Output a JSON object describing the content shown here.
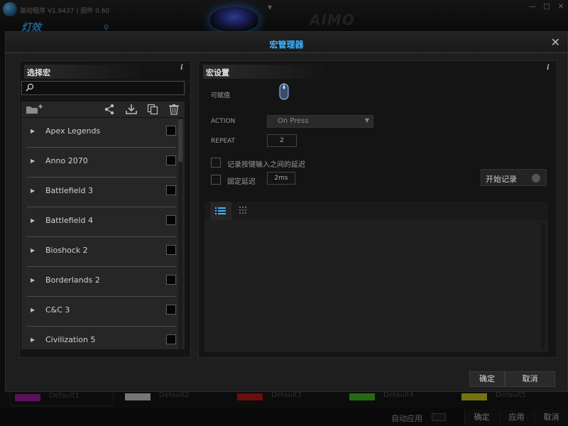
{
  "app": {
    "version_text": "驱动程序 V1.9437 | 固件 0.60",
    "nav_left_label": "灯效",
    "banner_text": "AIMO",
    "window_controls": {
      "minimize": "—",
      "maximize": "□",
      "close": "✕"
    }
  },
  "profiles": [
    {
      "name": "Default1",
      "color": "#a31fa8"
    },
    {
      "name": "Default2",
      "color": "#d8d8d8"
    },
    {
      "name": "Default3",
      "color": "#c21a1a"
    },
    {
      "name": "Default4",
      "color": "#45c020"
    },
    {
      "name": "Default5",
      "color": "#d8d020"
    }
  ],
  "bottom_bar": {
    "auto_apply_label": "自动应用",
    "ok_label": "确定",
    "apply_label": "应用",
    "cancel_label": "取消"
  },
  "dialog": {
    "title": "宏管理器",
    "close_glyph": "✕",
    "ok_label": "确定",
    "cancel_label": "取消",
    "accent_color": "#3fb4ff"
  },
  "left_panel": {
    "title": "选择宏",
    "info_glyph": "i",
    "search_placeholder": "",
    "toolbar_icons": [
      "folder-add-icon",
      "share-icon",
      "download-icon",
      "copy-icon",
      "trash-icon"
    ],
    "items": [
      {
        "name": "Apex Legends"
      },
      {
        "name": "Anno 2070"
      },
      {
        "name": "Battlefield 3"
      },
      {
        "name": "Battlefield 4"
      },
      {
        "name": "Bioshock 2"
      },
      {
        "name": "Borderlands 2"
      },
      {
        "name": "C&C 3"
      },
      {
        "name": "Civilization 5"
      }
    ]
  },
  "right_panel": {
    "title": "宏设置",
    "info_glyph": "i",
    "assign_label": "可赋值",
    "action_label": "ACTION",
    "action_value": "On Press",
    "repeat_label": "REPEAT",
    "repeat_value": "2",
    "record_delay_label": "记录按键输入之间的延迟",
    "fixed_delay_label": "固定延迟",
    "fixed_delay_value": "2ms",
    "record_button_label": "开始记录"
  }
}
